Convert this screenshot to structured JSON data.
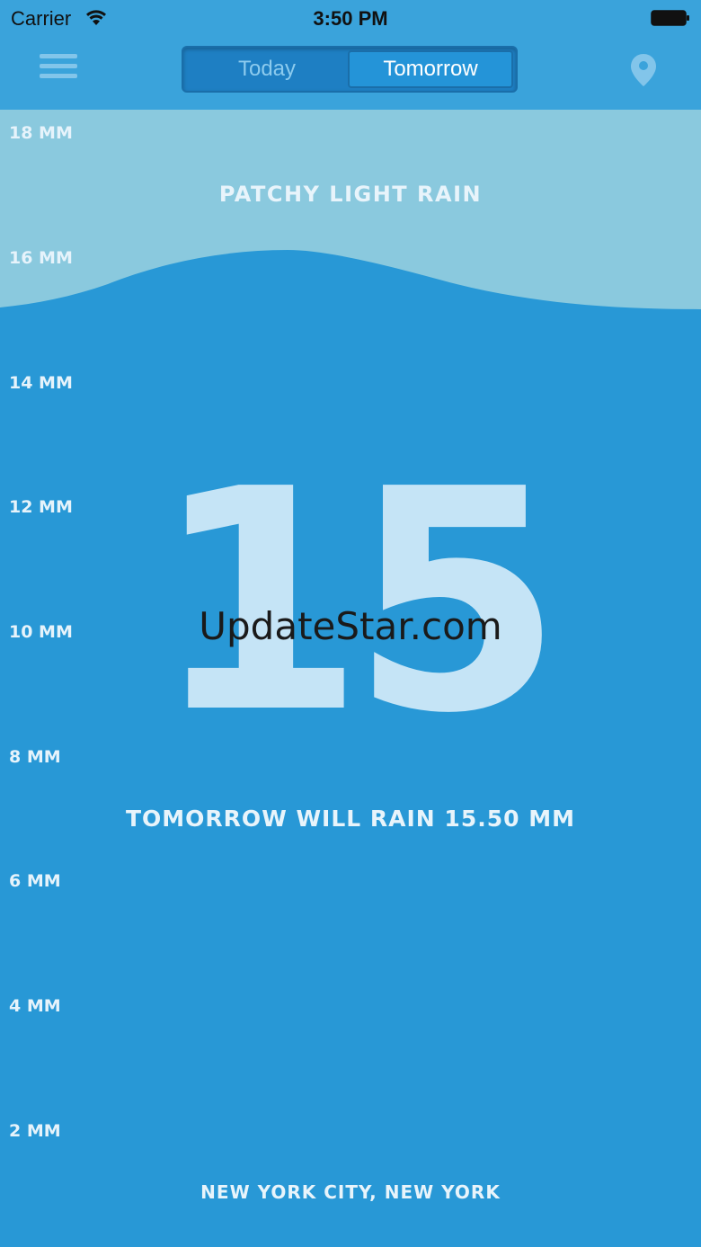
{
  "status_bar": {
    "carrier": "Carrier",
    "time": "3:50 PM",
    "icons": [
      "wifi-icon",
      "battery-icon"
    ]
  },
  "nav": {
    "menu_icon": "hamburger-menu-icon",
    "tabs": [
      {
        "label": "Today",
        "selected": false
      },
      {
        "label": "Tomorrow",
        "selected": true
      }
    ],
    "location_icon": "map-pin-icon"
  },
  "gauge": {
    "ticks": [
      "18 MM",
      "16 MM",
      "14 MM",
      "12 MM",
      "10 MM",
      "8 MM",
      "6 MM",
      "4 MM",
      "2 MM"
    ],
    "level_mm": 15.5
  },
  "condition": "PATCHY LIGHT RAIN",
  "big_value": "15",
  "watermark": "UpdateStar.com",
  "summary": "TOMORROW WILL RAIN 15.50 MM",
  "location": "NEW YORK CITY, NEW YORK",
  "colors": {
    "background": "#2898d6",
    "sky": "#8ac9de",
    "nav": "#3aa3db",
    "text": "#e8f4fb",
    "big_number": "#c5e4f6"
  }
}
